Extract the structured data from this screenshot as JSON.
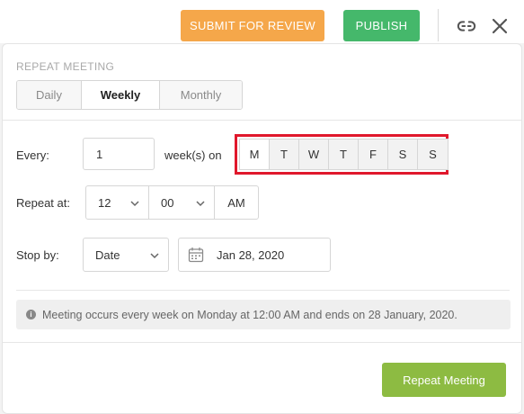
{
  "toolbar": {
    "submit_label": "SUBMIT FOR REVIEW",
    "publish_label": "PUBLISH",
    "unlink_icon": "unlink-icon",
    "close_icon": "close-icon",
    "colors": {
      "submit": "#f5a74a",
      "publish": "#45b86b"
    }
  },
  "repeat": {
    "section_title": "REPEAT MEETING",
    "tabs": [
      {
        "label": "Daily",
        "active": false
      },
      {
        "label": "Weekly",
        "active": true
      },
      {
        "label": "Monthly",
        "active": false
      }
    ],
    "every": {
      "label": "Every:",
      "value": "1",
      "suffix": "week(s) on",
      "days": [
        {
          "label": "M",
          "selected": true
        },
        {
          "label": "T",
          "selected": false
        },
        {
          "label": "W",
          "selected": false
        },
        {
          "label": "T",
          "selected": false
        },
        {
          "label": "F",
          "selected": false
        },
        {
          "label": "S",
          "selected": false
        },
        {
          "label": "S",
          "selected": false
        }
      ],
      "highlight_color": "#e0182c"
    },
    "repeat_at": {
      "label": "Repeat at:",
      "hour": "12",
      "minute": "00",
      "ampm": "AM"
    },
    "stop_by": {
      "label": "Stop by:",
      "type": "Date",
      "date": "Jan 28, 2020",
      "calendar_icon": "calendar-icon"
    },
    "info": {
      "icon": "info-icon",
      "text": "Meeting occurs every week on Monday at 12:00 AM and ends on 28 January, 2020."
    },
    "submit_label": "Repeat Meeting",
    "submit_color": "#8dbb42"
  }
}
